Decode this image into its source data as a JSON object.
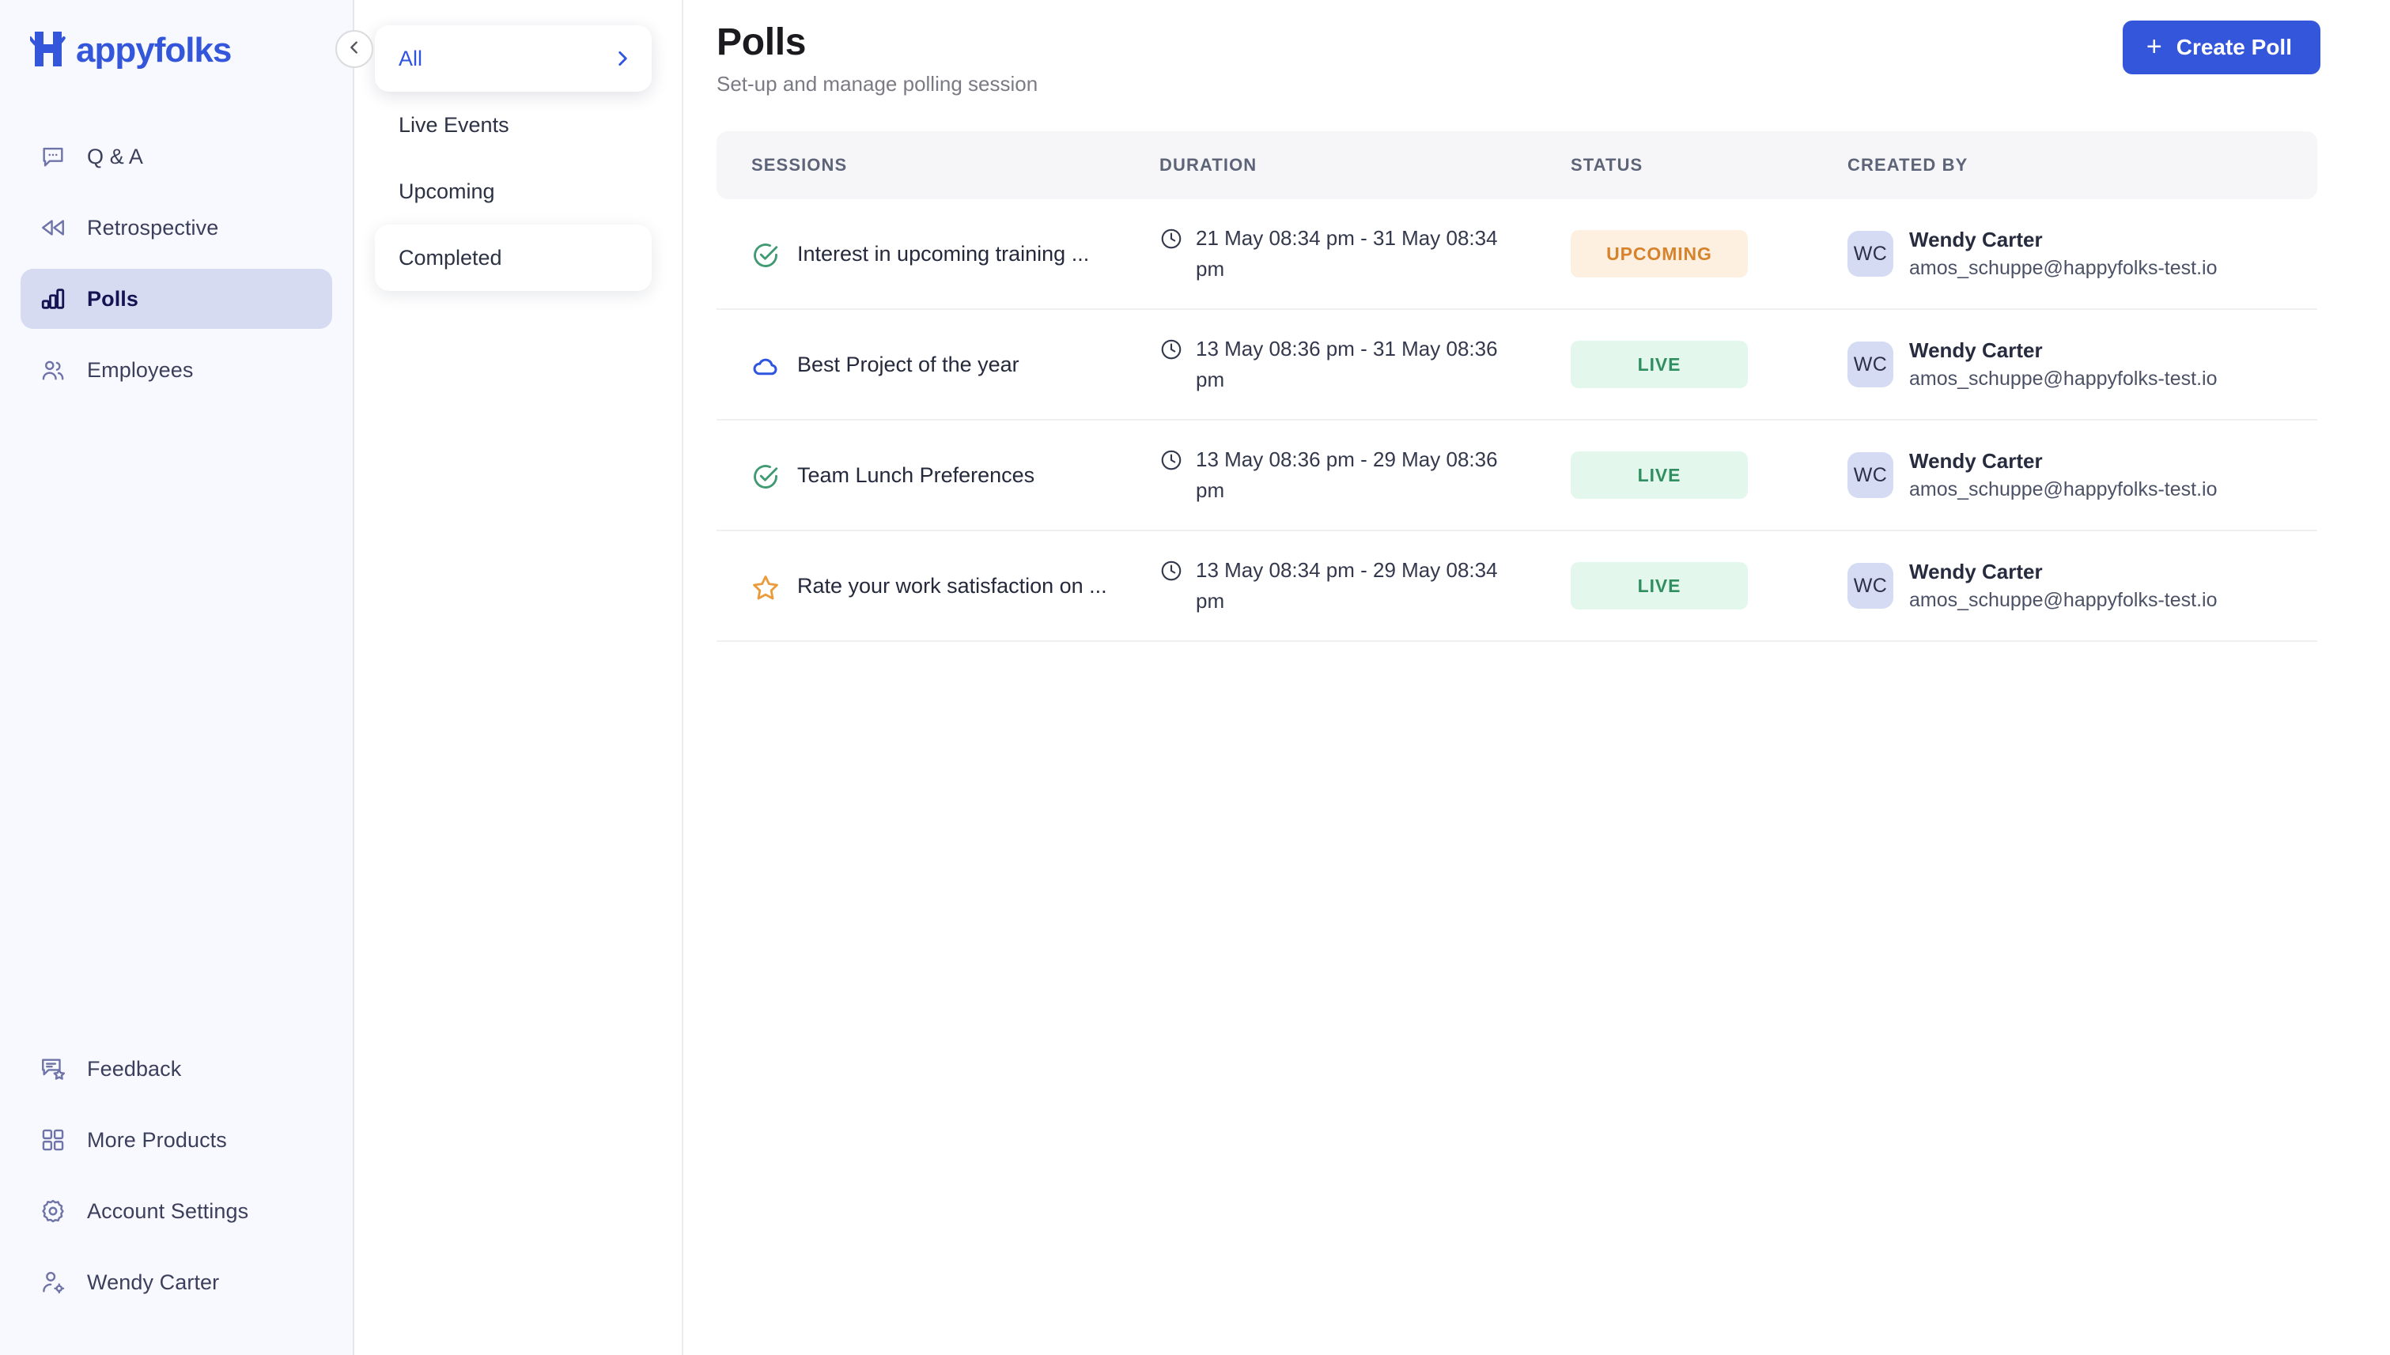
{
  "brand": {
    "name": "Happyfolks",
    "color": "#3456db"
  },
  "sidebar": {
    "collapse_icon": "chevron-left-icon",
    "top_items": [
      {
        "label": "Q & A",
        "icon": "chat-bubble-icon",
        "active": false
      },
      {
        "label": "Retrospective",
        "icon": "rewind-icon",
        "active": false
      },
      {
        "label": "Polls",
        "icon": "bar-chart-icon",
        "active": true
      },
      {
        "label": "Employees",
        "icon": "users-icon",
        "active": false
      }
    ],
    "bottom_items": [
      {
        "label": "Feedback",
        "icon": "feedback-star-icon"
      },
      {
        "label": "More Products",
        "icon": "grid-squares-icon"
      },
      {
        "label": "Account Settings",
        "icon": "gear-icon"
      },
      {
        "label": "Wendy Carter",
        "icon": "user-settings-icon"
      }
    ]
  },
  "filters": {
    "items": [
      {
        "label": "All",
        "state": "selected",
        "chevron": "chevron-right-icon"
      },
      {
        "label": "Live Events",
        "state": "default"
      },
      {
        "label": "Upcoming",
        "state": "default"
      },
      {
        "label": "Completed",
        "state": "card"
      }
    ]
  },
  "header": {
    "title": "Polls",
    "subtitle": "Set-up and manage polling session",
    "create_button": {
      "label": "Create Poll",
      "icon": "plus-icon",
      "color": "#3456db"
    }
  },
  "table": {
    "columns": [
      "SESSIONS",
      "DURATION",
      "STATUS",
      "CREATED BY"
    ],
    "rows": [
      {
        "icon": "check-circle-icon",
        "icon_color": "#3f9a72",
        "session": "Interest in upcoming training ...",
        "duration": "21 May 08:34 pm - 31 May 08:34 pm",
        "duration_icon": "clock-icon",
        "status": "UPCOMING",
        "status_kind": "upcoming",
        "creator_initials": "WC",
        "creator_name": "Wendy Carter",
        "creator_email": "amos_schuppe@happyfolks-test.io"
      },
      {
        "icon": "cloud-icon",
        "icon_color": "#2f55e0",
        "session": "Best Project of the year",
        "duration": "13 May 08:36 pm - 31 May 08:36 pm",
        "duration_icon": "clock-icon",
        "status": "LIVE",
        "status_kind": "live",
        "creator_initials": "WC",
        "creator_name": "Wendy Carter",
        "creator_email": "amos_schuppe@happyfolks-test.io"
      },
      {
        "icon": "check-circle-icon",
        "icon_color": "#3f9a72",
        "session": "Team Lunch Preferences",
        "duration": "13 May 08:36 pm - 29 May 08:36 pm",
        "duration_icon": "clock-icon",
        "status": "LIVE",
        "status_kind": "live",
        "creator_initials": "WC",
        "creator_name": "Wendy Carter",
        "creator_email": "amos_schuppe@happyfolks-test.io"
      },
      {
        "icon": "star-icon",
        "icon_color": "#eb9b3b",
        "session": "Rate your work satisfaction on ...",
        "duration": "13 May 08:34 pm - 29 May 08:34 pm",
        "duration_icon": "clock-icon",
        "status": "LIVE",
        "status_kind": "live",
        "creator_initials": "WC",
        "creator_name": "Wendy Carter",
        "creator_email": "amos_schuppe@happyfolks-test.io"
      }
    ]
  }
}
